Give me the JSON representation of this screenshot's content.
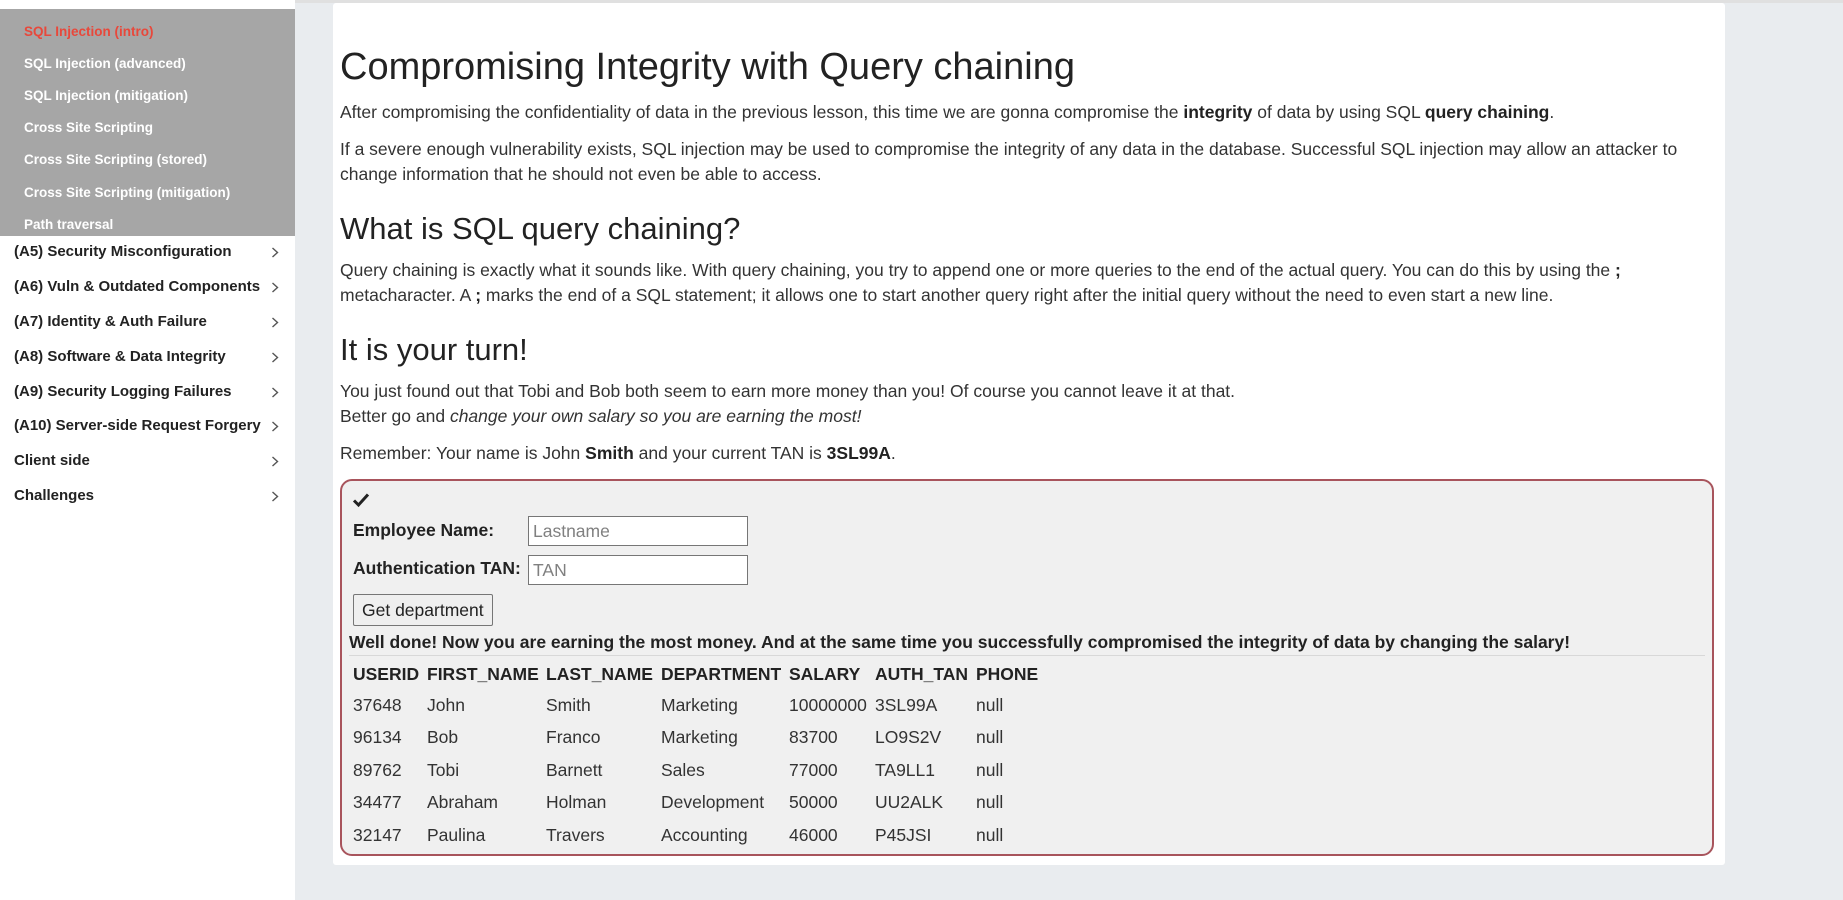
{
  "sidebar": {
    "sub_items": [
      {
        "label": "SQL Injection (intro)",
        "active": true
      },
      {
        "label": "SQL Injection (advanced)",
        "active": false
      },
      {
        "label": "SQL Injection (mitigation)",
        "active": false
      },
      {
        "label": "Cross Site Scripting",
        "active": false
      },
      {
        "label": "Cross Site Scripting (stored)",
        "active": false
      },
      {
        "label": "Cross Site Scripting (mitigation)",
        "active": false
      },
      {
        "label": "Path traversal",
        "active": false
      }
    ],
    "categories": [
      {
        "label": "(A5) Security Misconfiguration"
      },
      {
        "label": "(A6) Vuln & Outdated Components"
      },
      {
        "label": "(A7) Identity & Auth Failure"
      },
      {
        "label": "(A8) Software & Data Integrity"
      },
      {
        "label": "(A9) Security Logging Failures"
      },
      {
        "label": "(A10) Server-side Request Forgery"
      },
      {
        "label": "Client side"
      },
      {
        "label": "Challenges"
      }
    ]
  },
  "lesson": {
    "title": "Compromising Integrity with Query chaining",
    "intro": {
      "t1": "After compromising the confidentiality of data in the previous lesson, this time we are gonna compromise the ",
      "b1": "integrity",
      "t2": " of data by using SQL ",
      "b2": "query chaining",
      "t3": "."
    },
    "para2": "If a severe enough vulnerability exists, SQL injection may be used to compromise the integrity of any data in the database. Successful SQL injection may allow an attacker to change information that he should not even be able to access.",
    "h_chaining": "What is SQL query chaining?",
    "chaining": {
      "t1": "Query chaining is exactly what it sounds like. With query chaining, you try to append one or more queries to the end of the actual query. You can do this by using the ",
      "b1": ";",
      "t2": " metacharacter. A ",
      "b2": ";",
      "t3": " marks the end of a SQL statement; it allows one to start another query right after the initial query without the need to even start a new line."
    },
    "h_turn": "It is your turn!",
    "turn": {
      "line1": "You just found out that Tobi and Bob both seem to earn more money than you! Of course you cannot leave it at that.",
      "line2_plain": "Better go and ",
      "line2_em": "change your own salary so you are earning the most!"
    },
    "remember": {
      "t1": "Remember: Your name is John ",
      "b1": "Smith",
      "t2": " and your current TAN is ",
      "b2": "3SL99A",
      "t3": "."
    }
  },
  "assignment": {
    "check_icon": "checkmark-icon",
    "name_label": "Employee Name:",
    "name_placeholder": "Lastname",
    "tan_label": "Authentication TAN:",
    "tan_placeholder": "TAN",
    "button_label": "Get department",
    "feedback": "Well done! Now you are earning the most money. And at the same time you successfully compromised the integrity of data by changing the salary!",
    "table": {
      "headers": [
        "USERID",
        "FIRST_NAME",
        "LAST_NAME",
        "DEPARTMENT",
        "SALARY",
        "AUTH_TAN",
        "PHONE"
      ],
      "rows": [
        [
          "37648",
          "John",
          "Smith",
          "Marketing",
          "10000000",
          "3SL99A",
          "null"
        ],
        [
          "96134",
          "Bob",
          "Franco",
          "Marketing",
          "83700",
          "LO9S2V",
          "null"
        ],
        [
          "89762",
          "Tobi",
          "Barnett",
          "Sales",
          "77000",
          "TA9LL1",
          "null"
        ],
        [
          "34477",
          "Abraham",
          "Holman",
          "Development",
          "50000",
          "UU2ALK",
          "null"
        ],
        [
          "32147",
          "Paulina",
          "Travers",
          "Accounting",
          "46000",
          "P45JSI",
          "null"
        ]
      ]
    }
  },
  "colors": {
    "active_link": "#e8483b",
    "submenu_bg": "#a6a6a6",
    "assignment_border": "#a8545c"
  }
}
